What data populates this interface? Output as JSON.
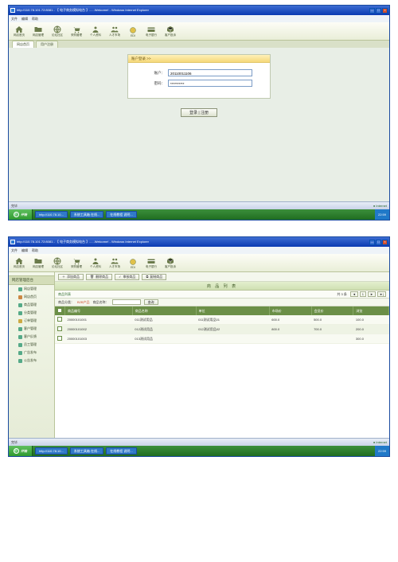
{
  "window": {
    "title": "http://110.78.101.72:8081 - 【 电子商务模拟电台 】......Welcome! - Windows Internet Explorer",
    "menu": [
      "文件",
      "编辑",
      "帮助"
    ],
    "address_prefix": "地址",
    "url": "http://110.78.101.72:8081",
    "go": "转到"
  },
  "toolbar": {
    "items": [
      {
        "icon": "home",
        "label": "网店首页"
      },
      {
        "icon": "folder",
        "label": "网店管理"
      },
      {
        "icon": "globe",
        "label": "论坛社区"
      },
      {
        "icon": "cart",
        "label": "采购管理"
      },
      {
        "icon": "user",
        "label": "个人资料"
      },
      {
        "icon": "people",
        "label": "人才市场"
      },
      {
        "icon": "coin",
        "label": "EDI"
      },
      {
        "icon": "card",
        "label": "电子银行"
      },
      {
        "icon": "box",
        "label": "客户投诉"
      }
    ]
  },
  "tabs": {
    "t1": "网店首页",
    "t2": "用户注册"
  },
  "login": {
    "header": "账户登录 >>",
    "user_lbl": "账户：",
    "user_val": "20110011106",
    "pwd_lbl": "密码：",
    "pwd_val": "**********",
    "btn": "登录 | 注册"
  },
  "sidebar": {
    "title": "网店管理后台",
    "items": [
      "网店管理",
      "网店首页",
      "商品管理",
      "分类管理",
      "订单管理",
      "客户管理",
      "客户反馈",
      "员工管理",
      "广告发布",
      "公告发布"
    ]
  },
  "detail_toolbar": {
    "b1": "添加商品",
    "b2": "删除商品",
    "b3": "审核商品",
    "b4": "复制商品"
  },
  "page_title": "商 品 列 表",
  "actionbar": {
    "link": "商品列表",
    "count_lbl": "共 3 条"
  },
  "filter": {
    "lbl": "商品分类：",
    "chip": "B2B产品",
    "name_lbl": "商品名称：",
    "btn": "查询"
  },
  "table": {
    "cols": [
      "",
      "商品编号",
      "商品名称",
      "单位",
      "市场价",
      "会员价",
      "浏览"
    ],
    "rows": [
      [
        "",
        "20000101001",
        "011测试用品",
        "011测试用品01",
        "600.0",
        "500.0",
        "100.0"
      ],
      [
        "",
        "20000101002",
        "012测试用品",
        "012测试用品02",
        "800.0",
        "700.0",
        "200.0"
      ],
      [
        "",
        "20000101003",
        "013测试用品",
        "",
        "",
        "",
        "300.0"
      ]
    ]
  },
  "pager": {
    "prev": "◄",
    "p1": "1",
    "next": "►",
    "last": "►|"
  },
  "status": {
    "left": "完毕",
    "right": "● Internet"
  },
  "taskbar": {
    "start": "开始",
    "tasks": [
      "http://110.78.10...",
      "系统工具箱 在线...",
      "在线教程 说明..."
    ],
    "time": "22:59"
  }
}
